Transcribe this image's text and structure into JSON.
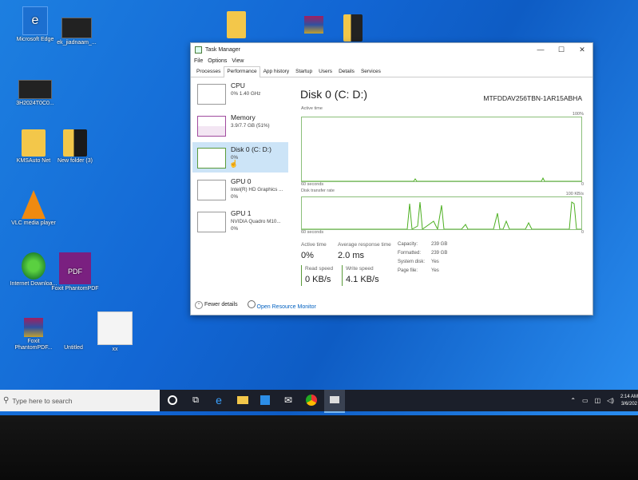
{
  "desktop": {
    "icons": [
      {
        "label": "Microsoft Edge"
      },
      {
        "label": "ek_jiadnaam_..."
      },
      {
        "label": "3H2024T0C0..."
      },
      {
        "label": "KMSAuto Net"
      },
      {
        "label": "New folder (3)"
      },
      {
        "label": "VLC media player"
      },
      {
        "label": "Internet Downloa..."
      },
      {
        "label": "Foxit PhantomPDF"
      },
      {
        "label": "Foxit PhantomPDF..."
      },
      {
        "label": "Untitled"
      },
      {
        "label": "xx"
      }
    ]
  },
  "window": {
    "title": "Task Manager",
    "controls": {
      "minimize": "—",
      "maximize": "☐",
      "close": "✕"
    },
    "menu": [
      "File",
      "Options",
      "View"
    ],
    "tabs": [
      "Processes",
      "Performance",
      "App history",
      "Startup",
      "Users",
      "Details",
      "Services"
    ],
    "active_tab": "Performance",
    "resources": [
      {
        "name": "CPU",
        "line1": "0% 1.40 GHz",
        "line2": ""
      },
      {
        "name": "Memory",
        "line1": "3.9/7.7 GB (51%)",
        "line2": ""
      },
      {
        "name": "Disk 0 (C: D:)",
        "line1": "0%",
        "line2": ""
      },
      {
        "name": "GPU 0",
        "line1": "Intel(R) HD Graphics ...",
        "line2": "0%"
      },
      {
        "name": "GPU 1",
        "line1": "NVIDIA Quadro M10...",
        "line2": "0%"
      }
    ],
    "selected_resource": 2,
    "detail": {
      "title": "Disk 0 (C: D:)",
      "model": "MTFDDAV256TBN-1AR15ABHA",
      "graph1_label": "Active time",
      "graph1_max": "100%",
      "graph1_time": "60 seconds",
      "graph1_min": "0",
      "graph2_label": "Disk transfer rate",
      "graph2_max": "100 KB/s",
      "graph2_time": "60 seconds",
      "graph2_min": "0",
      "active_time_label": "Active time",
      "active_time_value": "0%",
      "avg_response_label": "Average response time",
      "avg_response_value": "2.0 ms",
      "read_speed_label": "Read speed",
      "read_speed_value": "0 KB/s",
      "write_speed_label": "Write speed",
      "write_speed_value": "4.1 KB/s",
      "props": [
        {
          "k": "Capacity:",
          "v": "239 GB"
        },
        {
          "k": "Formatted:",
          "v": "239 GB"
        },
        {
          "k": "System disk:",
          "v": "Yes"
        },
        {
          "k": "Page file:",
          "v": "Yes"
        }
      ]
    },
    "footer": {
      "fewer": "Fewer details",
      "monitor": "Open Resource Monitor"
    }
  },
  "taskbar": {
    "search_placeholder": "Type here to search",
    "time": "2:14 AM",
    "date": "3/6/202",
    "graph_color": "#4caf20",
    "accent": "#1e7ae0"
  }
}
